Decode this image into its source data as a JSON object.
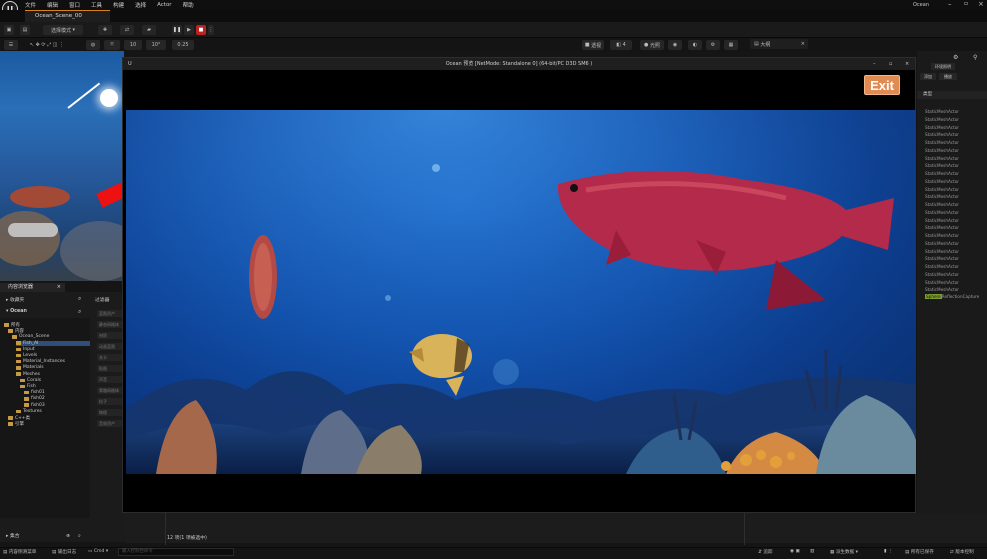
{
  "menu": {
    "items": [
      "文件",
      "编辑",
      "窗口",
      "工具",
      "构建",
      "选择",
      "Actor",
      "帮助"
    ],
    "project_name": "Ocean"
  },
  "tab": {
    "level_name": "Ocean_Scene_00"
  },
  "toolbar": {
    "mode_label": "选择模式"
  },
  "viewport_toolbar": {
    "perspective": "透视",
    "lit": "光照",
    "show": "显示",
    "grid_value": "10",
    "angle_value": "10°",
    "scale_value": "0.25",
    "camera_speed": "4"
  },
  "outliner": {
    "tab_label": "大纲",
    "buttons": [
      "环境照明",
      "添加",
      "播放"
    ],
    "column_header": "类型",
    "rows": [
      "StaticMeshActor",
      "StaticMeshActor",
      "StaticMeshActor",
      "StaticMeshActor",
      "StaticMeshActor",
      "StaticMeshActor",
      "StaticMeshActor",
      "StaticMeshActor",
      "StaticMeshActor",
      "StaticMeshActor",
      "StaticMeshActor",
      "StaticMeshActor",
      "StaticMeshActor",
      "StaticMeshActor",
      "StaticMeshActor",
      "StaticMeshActor",
      "StaticMeshActor",
      "StaticMeshActor",
      "StaticMeshActor",
      "StaticMeshActor",
      "StaticMeshActor",
      "StaticMeshActor",
      "StaticMeshActor",
      "StaticMeshActor"
    ],
    "selected_badge": "Sphere",
    "selected_row": "ReflectionCapture"
  },
  "game_window": {
    "title": "Ocean 预览 [NetMode: Standalone 0]  (64-bit/PC D3D SM6 )",
    "exit_label": "Exit"
  },
  "content_browser": {
    "tab_label": "内容浏览器",
    "favorites_label": "收藏夹",
    "filters_label": "过滤器",
    "project_label": "Ocean",
    "tree": [
      {
        "label": "所有",
        "depth": 0
      },
      {
        "label": "内容",
        "depth": 1
      },
      {
        "label": "Ocean_Scene",
        "depth": 2
      },
      {
        "label": "Fish_AI",
        "depth": 3
      },
      {
        "label": "Input",
        "depth": 3
      },
      {
        "label": "Levels",
        "depth": 3
      },
      {
        "label": "Material_Instances",
        "depth": 3
      },
      {
        "label": "Materials",
        "depth": 3
      },
      {
        "label": "Meshes",
        "depth": 3
      },
      {
        "label": "Corals",
        "depth": 4
      },
      {
        "label": "Fish",
        "depth": 4
      },
      {
        "label": "fish01",
        "depth": 5
      },
      {
        "label": "fish02",
        "depth": 5
      },
      {
        "label": "fish03",
        "depth": 5
      },
      {
        "label": "Textures",
        "depth": 3
      },
      {
        "label": "C++类",
        "depth": 1
      },
      {
        "label": "引擎",
        "depth": 1
      }
    ],
    "filters": [
      "蓝图资产",
      "静态网格体",
      "材质",
      "动画蓝图",
      "关卡",
      "贴图",
      "声音",
      "骨骼网格体",
      "粒子",
      "物理",
      "音效资产"
    ],
    "collections_label": "集合",
    "item_count": "12 项(1 项被选中)"
  },
  "status_bar": {
    "content_drawer": "内容侧滑菜单",
    "output_log": "输出日志",
    "cmd": "Cmd",
    "cmd_placeholder": "输入控制台命令",
    "trace": "追踪",
    "derived_data": "派生数据",
    "all_saved": "所有已保存",
    "source_control": "版本控制"
  }
}
